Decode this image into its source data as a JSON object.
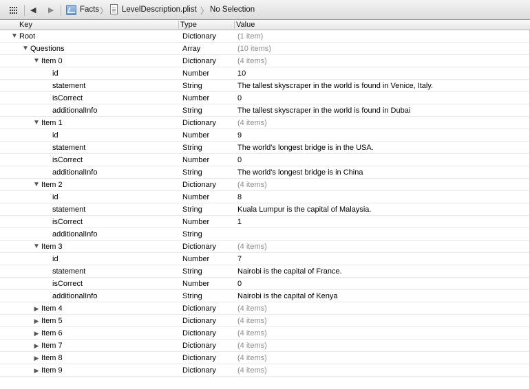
{
  "jumpbar": {
    "crumbs": [
      "Facts",
      "LevelDescription.plist",
      "No Selection"
    ],
    "back_glyph": "◀",
    "forward_glyph": "▶",
    "chevron": "〉"
  },
  "header": {
    "key": "Key",
    "type": "Type",
    "value": "Value"
  },
  "rows": [
    {
      "key": "Root",
      "type": "Dictionary",
      "value": "(1 item)",
      "level": 0,
      "disclosure": "open",
      "muted": true
    },
    {
      "key": "Questions",
      "type": "Array",
      "value": "(10 items)",
      "level": 1,
      "disclosure": "open",
      "muted": true
    },
    {
      "key": "Item 0",
      "type": "Dictionary",
      "value": "(4 items)",
      "level": 2,
      "disclosure": "open",
      "muted": true
    },
    {
      "key": "id",
      "type": "Number",
      "value": "10",
      "level": 3,
      "disclosure": "none",
      "muted": false
    },
    {
      "key": "statement",
      "type": "String",
      "value": "The tallest skyscraper in the world is found in Venice, Italy.",
      "level": 3,
      "disclosure": "none",
      "muted": false
    },
    {
      "key": "isCorrect",
      "type": "Number",
      "value": "0",
      "level": 3,
      "disclosure": "none",
      "muted": false
    },
    {
      "key": "additionalInfo",
      "type": "String",
      "value": "The tallest skyscraper in the world is found in Dubai",
      "level": 3,
      "disclosure": "none",
      "muted": false
    },
    {
      "key": "Item 1",
      "type": "Dictionary",
      "value": "(4 items)",
      "level": 2,
      "disclosure": "open",
      "muted": true
    },
    {
      "key": "id",
      "type": "Number",
      "value": "9",
      "level": 3,
      "disclosure": "none",
      "muted": false
    },
    {
      "key": "statement",
      "type": "String",
      "value": "The world's longest bridge is in the USA.",
      "level": 3,
      "disclosure": "none",
      "muted": false
    },
    {
      "key": "isCorrect",
      "type": "Number",
      "value": "0",
      "level": 3,
      "disclosure": "none",
      "muted": false
    },
    {
      "key": "additionalInfo",
      "type": "String",
      "value": "The world's longest bridge is in China",
      "level": 3,
      "disclosure": "none",
      "muted": false
    },
    {
      "key": "Item 2",
      "type": "Dictionary",
      "value": "(4 items)",
      "level": 2,
      "disclosure": "open",
      "muted": true
    },
    {
      "key": "id",
      "type": "Number",
      "value": "8",
      "level": 3,
      "disclosure": "none",
      "muted": false
    },
    {
      "key": "statement",
      "type": "String",
      "value": "Kuala Lumpur is the capital of Malaysia.",
      "level": 3,
      "disclosure": "none",
      "muted": false
    },
    {
      "key": "isCorrect",
      "type": "Number",
      "value": "1",
      "level": 3,
      "disclosure": "none",
      "muted": false
    },
    {
      "key": "additionalInfo",
      "type": "String",
      "value": "",
      "level": 3,
      "disclosure": "none",
      "muted": false
    },
    {
      "key": "Item 3",
      "type": "Dictionary",
      "value": "(4 items)",
      "level": 2,
      "disclosure": "open",
      "muted": true
    },
    {
      "key": "id",
      "type": "Number",
      "value": "7",
      "level": 3,
      "disclosure": "none",
      "muted": false
    },
    {
      "key": "statement",
      "type": "String",
      "value": "Nairobi is the capital of France.",
      "level": 3,
      "disclosure": "none",
      "muted": false
    },
    {
      "key": "isCorrect",
      "type": "Number",
      "value": "0",
      "level": 3,
      "disclosure": "none",
      "muted": false
    },
    {
      "key": "additionalInfo",
      "type": "String",
      "value": "Nairobi is the capital of Kenya",
      "level": 3,
      "disclosure": "none",
      "muted": false
    },
    {
      "key": "Item 4",
      "type": "Dictionary",
      "value": "(4 items)",
      "level": 2,
      "disclosure": "closed",
      "muted": true
    },
    {
      "key": "Item 5",
      "type": "Dictionary",
      "value": "(4 items)",
      "level": 2,
      "disclosure": "closed",
      "muted": true
    },
    {
      "key": "Item 6",
      "type": "Dictionary",
      "value": "(4 items)",
      "level": 2,
      "disclosure": "closed",
      "muted": true
    },
    {
      "key": "Item 7",
      "type": "Dictionary",
      "value": "(4 items)",
      "level": 2,
      "disclosure": "closed",
      "muted": true
    },
    {
      "key": "Item 8",
      "type": "Dictionary",
      "value": "(4 items)",
      "level": 2,
      "disclosure": "closed",
      "muted": true
    },
    {
      "key": "Item 9",
      "type": "Dictionary",
      "value": "(4 items)",
      "level": 2,
      "disclosure": "closed",
      "muted": true
    }
  ],
  "colors": {
    "muted_text": "#8b8b8b",
    "row_separator": "#e9e9e9",
    "header_border": "#b5b5b5"
  }
}
